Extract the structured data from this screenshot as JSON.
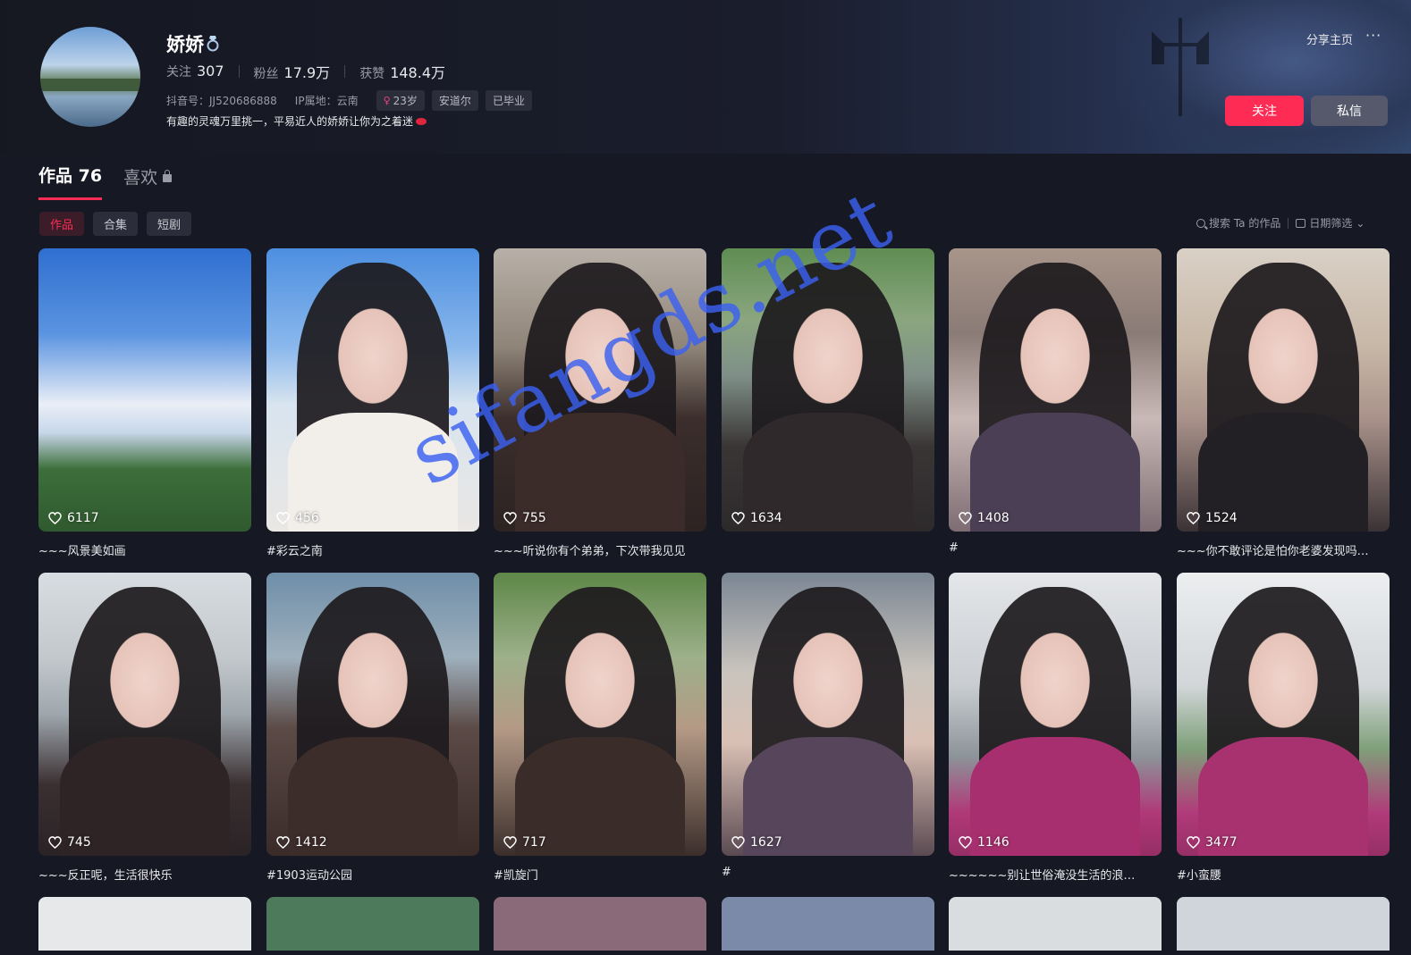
{
  "profile": {
    "nickname": "娇娇",
    "stats": [
      {
        "label": "关注",
        "value": "307"
      },
      {
        "label": "粉丝",
        "value": "17.9万"
      },
      {
        "label": "获赞",
        "value": "148.4万"
      }
    ],
    "douyin_id": "抖音号：JJ520686888",
    "ip_location": "IP属地：云南",
    "tags": [
      {
        "label": "23岁",
        "icon": "female-icon"
      },
      {
        "label": "安道尔"
      },
      {
        "label": "已毕业"
      }
    ],
    "bio": "有趣的灵魂万里挑一，平易近人的娇娇让你为之着迷"
  },
  "header": {
    "share_label": "分享主页",
    "more_label": "···",
    "follow_label": "关注",
    "message_label": "私信"
  },
  "tabs": [
    {
      "label": "作品 76",
      "active": true
    },
    {
      "label": "喜欢",
      "locked": true
    }
  ],
  "subtabs": [
    {
      "label": "作品",
      "active": true
    },
    {
      "label": "合集"
    },
    {
      "label": "短剧"
    }
  ],
  "tools": {
    "search_label": "搜索 Ta 的作品",
    "date_filter_label": "日期筛选"
  },
  "videos": [
    {
      "likes": "6117",
      "caption": "~~~风景美如画",
      "theme": "sky"
    },
    {
      "likes": "456",
      "caption": "#彩云之南",
      "theme": "sky-girl"
    },
    {
      "likes": "755",
      "caption": "~~~听说你有个弟弟，下次带我见见",
      "theme": "brown"
    },
    {
      "likes": "1634",
      "caption": "",
      "theme": "lake"
    },
    {
      "likes": "1408",
      "caption": "#",
      "theme": "floral"
    },
    {
      "likes": "1524",
      "caption": "~~~你不敢评论是怕你老婆发现吗…",
      "theme": "room"
    },
    {
      "likes": "745",
      "caption": "~~~反正呢，生活很快乐",
      "theme": "pier"
    },
    {
      "likes": "1412",
      "caption": "#1903运动公园",
      "theme": "brown2"
    },
    {
      "likes": "717",
      "caption": "#凯旋门",
      "theme": "park"
    },
    {
      "likes": "1627",
      "caption": "#",
      "theme": "curtain"
    },
    {
      "likes": "1146",
      "caption": "~~~~~~别让世俗淹没生活的浪…",
      "theme": "tower"
    },
    {
      "likes": "3477",
      "caption": "#小蛮腰",
      "theme": "tower2"
    }
  ],
  "watermark": "sifangds.net",
  "colors": {
    "accent": "#fe2c55",
    "background": "#161823",
    "secondary_button": "#56596b",
    "watermark": "#3a60f0"
  }
}
